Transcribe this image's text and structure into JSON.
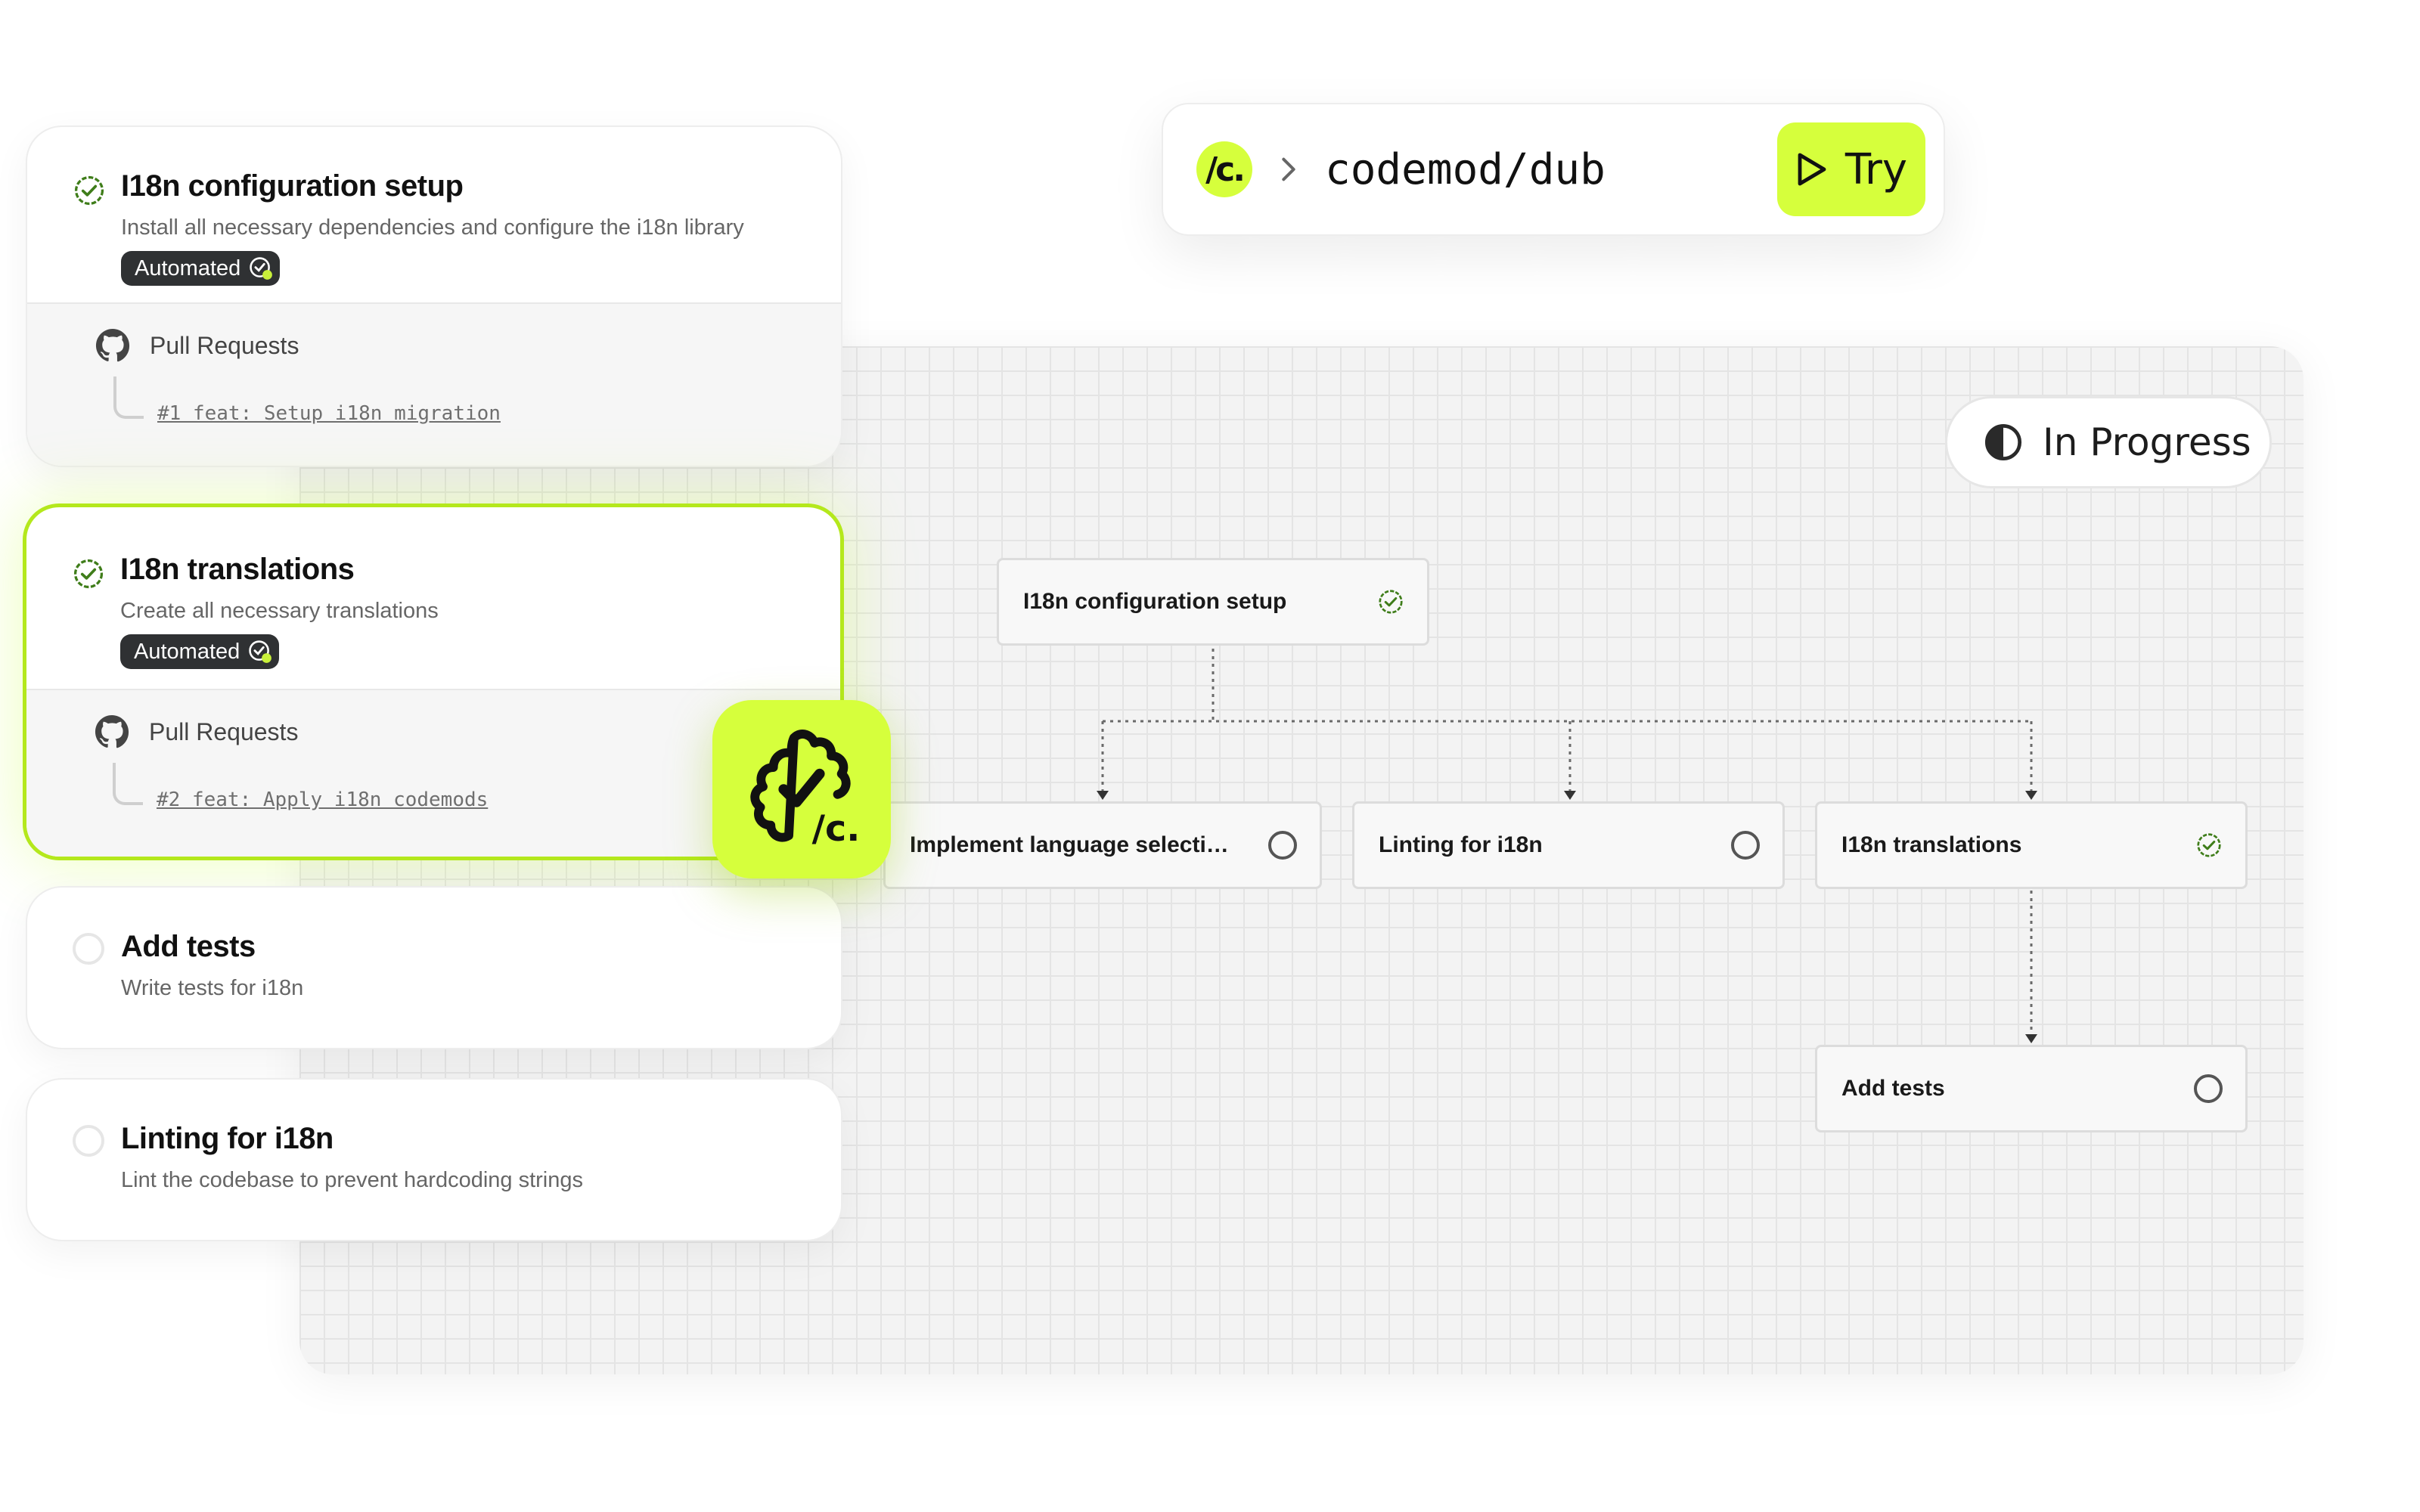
{
  "repo": {
    "logo_text": "/c.",
    "name": "codemod/dub",
    "try_label": "Try"
  },
  "status": {
    "label": "In Progress"
  },
  "cards": [
    {
      "title": "I18n configuration setup",
      "description": "Install all necessary dependencies and configure the i18n library",
      "badge": "Automated",
      "pr_header": "Pull Requests",
      "pr_link": "#1 feat: Setup i18n migration",
      "done": true
    },
    {
      "title": "I18n translations",
      "description": "Create all necessary translations",
      "badge": "Automated",
      "pr_header": "Pull Requests",
      "pr_link": "#2 feat: Apply i18n codemods",
      "done": true
    },
    {
      "title": "Add tests",
      "description": "Write tests for i18n",
      "done": false
    },
    {
      "title": "Linting for i18n",
      "description": "Lint the codebase to prevent hardcoding strings",
      "done": false
    }
  ],
  "app_badge": {
    "text": "/c."
  },
  "flow": {
    "nodes": [
      {
        "id": "config",
        "label": "I18n configuration setup",
        "done": true
      },
      {
        "id": "lang",
        "label": "Implement language selecti…",
        "done": false
      },
      {
        "id": "lint",
        "label": "Linting for i18n",
        "done": false
      },
      {
        "id": "trans",
        "label": "I18n translations",
        "done": true
      },
      {
        "id": "tests",
        "label": "Add tests",
        "done": false
      }
    ]
  },
  "colors": {
    "accent": "#d6ff3c",
    "active_border": "#b4e81c",
    "check_green": "#3f7d1a",
    "badge_bg": "#2f3133"
  }
}
